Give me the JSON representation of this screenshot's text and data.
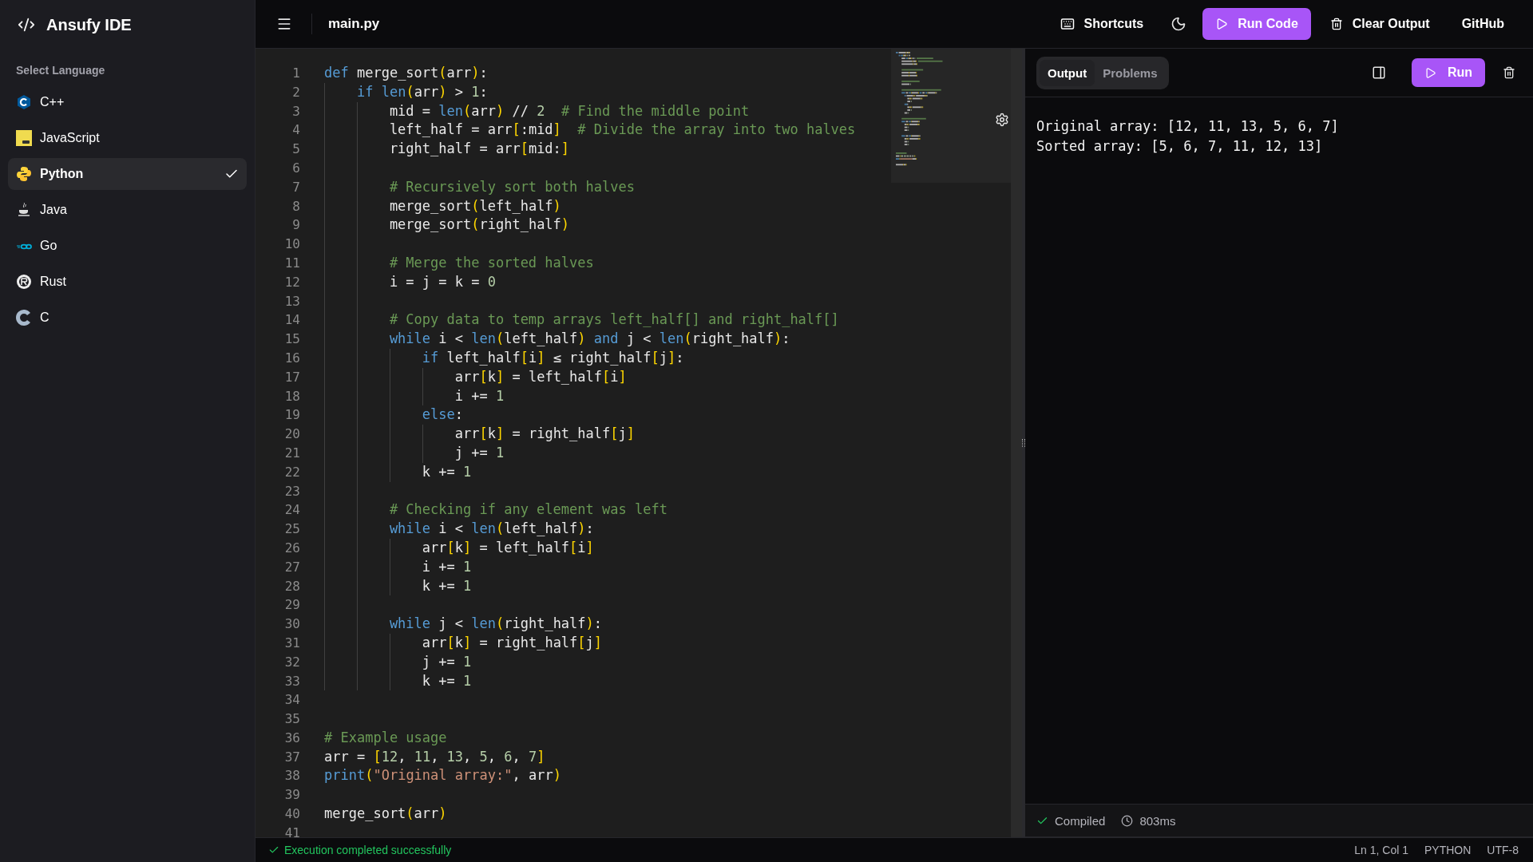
{
  "app": {
    "title": "Ansufy IDE"
  },
  "sidebar": {
    "heading": "Select Language",
    "languages": [
      {
        "label": "C++",
        "selected": false
      },
      {
        "label": "JavaScript",
        "selected": false
      },
      {
        "label": "Python",
        "selected": true
      },
      {
        "label": "Java",
        "selected": false
      },
      {
        "label": "Go",
        "selected": false
      },
      {
        "label": "Rust",
        "selected": false
      },
      {
        "label": "C",
        "selected": false
      }
    ]
  },
  "topbar": {
    "filename": "main.py",
    "actions": [
      {
        "kind": "shortcuts",
        "label": "Shortcuts"
      },
      {
        "kind": "theme"
      },
      {
        "kind": "run",
        "label": "Run Code"
      },
      {
        "kind": "clear",
        "label": "Clear Output"
      },
      {
        "kind": "link",
        "label": "GitHub"
      }
    ]
  },
  "editor": {
    "lines": [
      {
        "number": "1",
        "tokens": [
          {
            "kind": "keyword",
            "text": "def"
          },
          {
            "kind": "name",
            "text": " merge_sort"
          },
          {
            "kind": "bracket",
            "text": "("
          },
          {
            "kind": "name",
            "text": "arr"
          },
          {
            "kind": "bracket",
            "text": ")"
          },
          {
            "kind": "name",
            "text": ":"
          }
        ]
      },
      {
        "number": "2",
        "tokens": [
          {
            "kind": "keyword",
            "text": "    if"
          },
          {
            "kind": "keyword",
            "text": " len"
          },
          {
            "kind": "bracket",
            "text": "("
          },
          {
            "kind": "name",
            "text": "arr"
          },
          {
            "kind": "bracket",
            "text": ")"
          },
          {
            "kind": "name",
            "text": " > "
          },
          {
            "kind": "number",
            "text": "1"
          },
          {
            "kind": "name",
            "text": ":"
          }
        ]
      },
      {
        "number": "3",
        "tokens": [
          {
            "kind": "name",
            "text": "        mid = "
          },
          {
            "kind": "keyword",
            "text": "len"
          },
          {
            "kind": "bracket",
            "text": "("
          },
          {
            "kind": "name",
            "text": "arr"
          },
          {
            "kind": "bracket",
            "text": ")"
          },
          {
            "kind": "name",
            "text": " // "
          },
          {
            "kind": "number",
            "text": "2"
          },
          {
            "kind": "comment",
            "text": "  # Find the middle point"
          }
        ]
      },
      {
        "number": "4",
        "tokens": [
          {
            "kind": "name",
            "text": "        left_half = arr"
          },
          {
            "kind": "bracket",
            "text": "["
          },
          {
            "kind": "name",
            "text": ":mid"
          },
          {
            "kind": "bracket",
            "text": "]"
          },
          {
            "kind": "comment",
            "text": "  # Divide the array into two halves"
          }
        ]
      },
      {
        "number": "5",
        "tokens": [
          {
            "kind": "name",
            "text": "        right_half = arr"
          },
          {
            "kind": "bracket",
            "text": "["
          },
          {
            "kind": "name",
            "text": "mid:"
          },
          {
            "kind": "bracket",
            "text": "]"
          }
        ]
      },
      {
        "number": "6"
      },
      {
        "number": "7",
        "tokens": [
          {
            "kind": "comment",
            "text": "        # Recursively sort both halves"
          }
        ]
      },
      {
        "number": "8",
        "tokens": [
          {
            "kind": "name",
            "text": "        merge_sort"
          },
          {
            "kind": "bracket",
            "text": "("
          },
          {
            "kind": "name",
            "text": "left_half"
          },
          {
            "kind": "bracket",
            "text": ")"
          }
        ]
      },
      {
        "number": "9",
        "tokens": [
          {
            "kind": "name",
            "text": "        merge_sort"
          },
          {
            "kind": "bracket",
            "text": "("
          },
          {
            "kind": "name",
            "text": "right_half"
          },
          {
            "kind": "bracket",
            "text": ")"
          }
        ]
      },
      {
        "number": "10"
      },
      {
        "number": "11",
        "tokens": [
          {
            "kind": "comment",
            "text": "        # Merge the sorted halves"
          }
        ]
      },
      {
        "number": "12",
        "tokens": [
          {
            "kind": "name",
            "text": "        i = j = k = "
          },
          {
            "kind": "number",
            "text": "0"
          }
        ]
      },
      {
        "number": "13"
      },
      {
        "number": "14",
        "tokens": [
          {
            "kind": "comment",
            "text": "        # Copy data to temp arrays left_half[] and right_half[]"
          }
        ]
      },
      {
        "number": "15",
        "tokens": [
          {
            "kind": "keyword",
            "text": "        while"
          },
          {
            "kind": "name",
            "text": " i < "
          },
          {
            "kind": "keyword",
            "text": "len"
          },
          {
            "kind": "bracket",
            "text": "("
          },
          {
            "kind": "name",
            "text": "left_half"
          },
          {
            "kind": "bracket",
            "text": ")"
          },
          {
            "kind": "keyword",
            "text": " and"
          },
          {
            "kind": "name",
            "text": " j < "
          },
          {
            "kind": "keyword",
            "text": "len"
          },
          {
            "kind": "bracket",
            "text": "("
          },
          {
            "kind": "name",
            "text": "right_half"
          },
          {
            "kind": "bracket",
            "text": ")"
          },
          {
            "kind": "name",
            "text": ":"
          }
        ]
      },
      {
        "number": "16",
        "tokens": [
          {
            "kind": "keyword",
            "text": "            if"
          },
          {
            "kind": "name",
            "text": " left_half"
          },
          {
            "kind": "bracket",
            "text": "["
          },
          {
            "kind": "name",
            "text": "i"
          },
          {
            "kind": "bracket",
            "text": "]"
          },
          {
            "kind": "name",
            "text": " ≤ right_half"
          },
          {
            "kind": "bracket",
            "text": "["
          },
          {
            "kind": "name",
            "text": "j"
          },
          {
            "kind": "bracket",
            "text": "]"
          },
          {
            "kind": "name",
            "text": ":"
          }
        ]
      },
      {
        "number": "17",
        "tokens": [
          {
            "kind": "name",
            "text": "                arr"
          },
          {
            "kind": "bracket",
            "text": "["
          },
          {
            "kind": "name",
            "text": "k"
          },
          {
            "kind": "bracket",
            "text": "]"
          },
          {
            "kind": "name",
            "text": " = left_half"
          },
          {
            "kind": "bracket",
            "text": "["
          },
          {
            "kind": "name",
            "text": "i"
          },
          {
            "kind": "bracket",
            "text": "]"
          }
        ]
      },
      {
        "number": "18",
        "tokens": [
          {
            "kind": "name",
            "text": "                i += "
          },
          {
            "kind": "number",
            "text": "1"
          }
        ]
      },
      {
        "number": "19",
        "tokens": [
          {
            "kind": "keyword",
            "text": "            else"
          },
          {
            "kind": "name",
            "text": ":"
          }
        ]
      },
      {
        "number": "20",
        "tokens": [
          {
            "kind": "name",
            "text": "                arr"
          },
          {
            "kind": "bracket",
            "text": "["
          },
          {
            "kind": "name",
            "text": "k"
          },
          {
            "kind": "bracket",
            "text": "]"
          },
          {
            "kind": "name",
            "text": " = right_half"
          },
          {
            "kind": "bracket",
            "text": "["
          },
          {
            "kind": "name",
            "text": "j"
          },
          {
            "kind": "bracket",
            "text": "]"
          }
        ]
      },
      {
        "number": "21",
        "tokens": [
          {
            "kind": "name",
            "text": "                j += "
          },
          {
            "kind": "number",
            "text": "1"
          }
        ]
      },
      {
        "number": "22",
        "tokens": [
          {
            "kind": "name",
            "text": "            k += "
          },
          {
            "kind": "number",
            "text": "1"
          }
        ]
      },
      {
        "number": "23"
      },
      {
        "number": "24",
        "tokens": [
          {
            "kind": "comment",
            "text": "        # Checking if any element was left"
          }
        ]
      },
      {
        "number": "25",
        "tokens": [
          {
            "kind": "keyword",
            "text": "        while"
          },
          {
            "kind": "name",
            "text": " i < "
          },
          {
            "kind": "keyword",
            "text": "len"
          },
          {
            "kind": "bracket",
            "text": "("
          },
          {
            "kind": "name",
            "text": "left_half"
          },
          {
            "kind": "bracket",
            "text": ")"
          },
          {
            "kind": "name",
            "text": ":"
          }
        ]
      },
      {
        "number": "26",
        "tokens": [
          {
            "kind": "name",
            "text": "            arr"
          },
          {
            "kind": "bracket",
            "text": "["
          },
          {
            "kind": "name",
            "text": "k"
          },
          {
            "kind": "bracket",
            "text": "]"
          },
          {
            "kind": "name",
            "text": " = left_half"
          },
          {
            "kind": "bracket",
            "text": "["
          },
          {
            "kind": "name",
            "text": "i"
          },
          {
            "kind": "bracket",
            "text": "]"
          }
        ]
      },
      {
        "number": "27",
        "tokens": [
          {
            "kind": "name",
            "text": "            i += "
          },
          {
            "kind": "number",
            "text": "1"
          }
        ]
      },
      {
        "number": "28",
        "tokens": [
          {
            "kind": "name",
            "text": "            k += "
          },
          {
            "kind": "number",
            "text": "1"
          }
        ]
      },
      {
        "number": "29"
      },
      {
        "number": "30",
        "tokens": [
          {
            "kind": "keyword",
            "text": "        while"
          },
          {
            "kind": "name",
            "text": " j < "
          },
          {
            "kind": "keyword",
            "text": "len"
          },
          {
            "kind": "bracket",
            "text": "("
          },
          {
            "kind": "name",
            "text": "right_half"
          },
          {
            "kind": "bracket",
            "text": ")"
          },
          {
            "kind": "name",
            "text": ":"
          }
        ]
      },
      {
        "number": "31",
        "tokens": [
          {
            "kind": "name",
            "text": "            arr"
          },
          {
            "kind": "bracket",
            "text": "["
          },
          {
            "kind": "name",
            "text": "k"
          },
          {
            "kind": "bracket",
            "text": "]"
          },
          {
            "kind": "name",
            "text": " = right_half"
          },
          {
            "kind": "bracket",
            "text": "["
          },
          {
            "kind": "name",
            "text": "j"
          },
          {
            "kind": "bracket",
            "text": "]"
          }
        ]
      },
      {
        "number": "32",
        "tokens": [
          {
            "kind": "name",
            "text": "            j += "
          },
          {
            "kind": "number",
            "text": "1"
          }
        ]
      },
      {
        "number": "33",
        "tokens": [
          {
            "kind": "name",
            "text": "            k += "
          },
          {
            "kind": "number",
            "text": "1"
          }
        ]
      },
      {
        "number": "34"
      },
      {
        "number": "35"
      },
      {
        "number": "36",
        "tokens": [
          {
            "kind": "comment",
            "text": "# Example usage"
          }
        ]
      },
      {
        "number": "37",
        "tokens": [
          {
            "kind": "name",
            "text": "arr = "
          },
          {
            "kind": "bracket",
            "text": "["
          },
          {
            "kind": "number",
            "text": "12"
          },
          {
            "kind": "name",
            "text": ", "
          },
          {
            "kind": "number",
            "text": "11"
          },
          {
            "kind": "name",
            "text": ", "
          },
          {
            "kind": "number",
            "text": "13"
          },
          {
            "kind": "name",
            "text": ", "
          },
          {
            "kind": "number",
            "text": "5"
          },
          {
            "kind": "name",
            "text": ", "
          },
          {
            "kind": "number",
            "text": "6"
          },
          {
            "kind": "name",
            "text": ", "
          },
          {
            "kind": "number",
            "text": "7"
          },
          {
            "kind": "bracket",
            "text": "]"
          }
        ]
      },
      {
        "number": "38",
        "tokens": [
          {
            "kind": "keyword",
            "text": "print"
          },
          {
            "kind": "bracket",
            "text": "("
          },
          {
            "kind": "string",
            "text": "\"Original array:\""
          },
          {
            "kind": "name",
            "text": ", arr"
          },
          {
            "kind": "bracket",
            "text": ")"
          }
        ]
      },
      {
        "number": "39"
      },
      {
        "number": "40",
        "tokens": [
          {
            "kind": "name",
            "text": "merge_sort"
          },
          {
            "kind": "bracket",
            "text": "("
          },
          {
            "kind": "name",
            "text": "arr"
          },
          {
            "kind": "bracket",
            "text": ")"
          }
        ]
      },
      {
        "number": "41"
      }
    ]
  },
  "output": {
    "tabs": [
      {
        "label": "Output",
        "selected": true
      },
      {
        "label": "Problems",
        "selected": false
      }
    ],
    "run_label": "Run",
    "lines": [
      "Original array: [12, 11, 13, 5, 6, 7]",
      "Sorted array: [5, 6, 7, 11, 12, 13]"
    ],
    "footer": {
      "status": "Compiled",
      "ok": true,
      "time": "803ms"
    }
  },
  "status_bar": {
    "message": "Execution completed successfully",
    "success": true,
    "position": "Ln 1, Col 1",
    "language": "PYTHON",
    "encoding": "UTF-8"
  }
}
